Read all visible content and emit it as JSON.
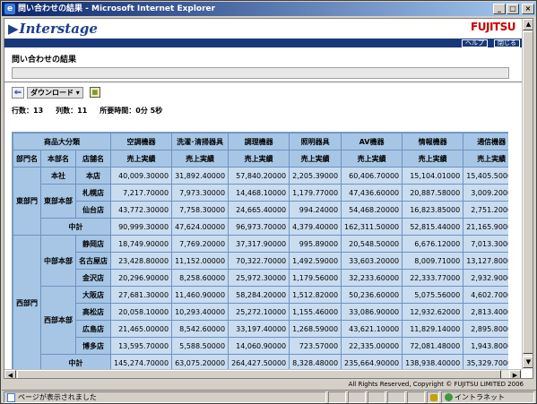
{
  "window": {
    "title": "問い合わせの結果 - Microsoft Internet Explorer",
    "buttons": [
      "_",
      "□",
      "×"
    ]
  },
  "header": {
    "logo": "Interstage",
    "brand": "FUJITSU",
    "help_label": "ヘルプ",
    "close_label": "閉じる"
  },
  "page": {
    "title": "問い合わせの結果",
    "download_label": "ダウンロード ▾",
    "stats": {
      "rows": "行数：13",
      "cols": "列数：11",
      "elapsed": "所要時間：0分 5秒"
    }
  },
  "table": {
    "category_header": "商品大分類",
    "row_headers": [
      "部門名",
      "本部名",
      "店舗名"
    ],
    "columns": [
      "空調機器",
      "洗濯･清掃器具",
      "調理機器",
      "照明器具",
      "AV機器",
      "情報機器",
      "通信機器"
    ],
    "measure": "売上実績",
    "rows": [
      {
        "dept": "東部門",
        "hq": "本社",
        "store": "本店",
        "values": [
          "40,009.30000",
          "31,892.40000",
          "57,840.20000",
          "2,205.39000",
          "60,406.70000",
          "15,104.01000",
          "15,405.50000"
        ]
      },
      {
        "dept": "",
        "hq": "東部本部",
        "store": "札幌店",
        "values": [
          "7,217.70000",
          "7,973.30000",
          "14,468.10000",
          "1,179.77000",
          "47,436.60000",
          "20,887.58000",
          "3,009.20000"
        ]
      },
      {
        "dept": "",
        "hq": "",
        "store": "仙台店",
        "values": [
          "43,772.30000",
          "7,758.30000",
          "24,665.40000",
          "994.24000",
          "54,468.20000",
          "16,823.85000",
          "2,751.20000"
        ]
      },
      {
        "dept": "",
        "hq": "中計",
        "store": "",
        "values": [
          "90,999.30000",
          "47,624.00000",
          "96,973.70000",
          "4,379.40000",
          "162,311.50000",
          "52,815.44000",
          "21,165.90000"
        ]
      },
      {
        "dept": "西部門",
        "hq": "中部本部",
        "store": "静岡店",
        "values": [
          "18,749.90000",
          "7,769.20000",
          "37,317.90000",
          "995.89000",
          "20,548.50000",
          "6,676.12000",
          "7,013.30000"
        ]
      },
      {
        "dept": "",
        "hq": "",
        "store": "名古屋店",
        "values": [
          "23,428.80000",
          "11,152.00000",
          "70,322.70000",
          "1,492.59000",
          "33,603.20000",
          "8,009.71000",
          "13,127.80000"
        ]
      },
      {
        "dept": "",
        "hq": "",
        "store": "金沢店",
        "values": [
          "20,296.90000",
          "8,258.60000",
          "25,972.30000",
          "1,179.56000",
          "32,233.60000",
          "22,333.77000",
          "2,932.90000"
        ]
      },
      {
        "dept": "",
        "hq": "西部本部",
        "store": "大阪店",
        "values": [
          "27,681.30000",
          "11,460.90000",
          "58,284.20000",
          "1,512.82000",
          "50,236.60000",
          "5,075.56000",
          "4,602.70000"
        ]
      },
      {
        "dept": "",
        "hq": "",
        "store": "高松店",
        "values": [
          "20,058.10000",
          "10,293.40000",
          "25,272.10000",
          "1,155.46000",
          "33,086.90000",
          "12,932.62000",
          "2,813.40000"
        ]
      },
      {
        "dept": "",
        "hq": "",
        "store": "広島店",
        "values": [
          "21,465.00000",
          "8,542.60000",
          "33,197.40000",
          "1,268.59000",
          "43,621.10000",
          "11,829.14000",
          "2,895.80000"
        ]
      },
      {
        "dept": "",
        "hq": "",
        "store": "博多店",
        "values": [
          "13,595.70000",
          "5,588.50000",
          "14,060.90000",
          "723.57000",
          "22,335.00000",
          "72,081.48000",
          "1,943.80000"
        ]
      },
      {
        "dept": "",
        "hq": "中計",
        "store": "",
        "values": [
          "145,274.70000",
          "63,075.20000",
          "264,427.50000",
          "8,328.48000",
          "235,664.90000",
          "138,938.40000",
          "35,329.70000"
        ]
      }
    ]
  },
  "footer": {
    "copyright": "All Rights Reserved, Copyright © FUJITSU LIMITED 2006"
  },
  "statusbar": {
    "message": "ページが表示されました",
    "zone": "イントラネット"
  },
  "colors": {
    "navbar": "#17397a",
    "header_cell": "#a7c6e6",
    "data_cell": "#c9dcf0",
    "brand_red": "#cc0000"
  }
}
